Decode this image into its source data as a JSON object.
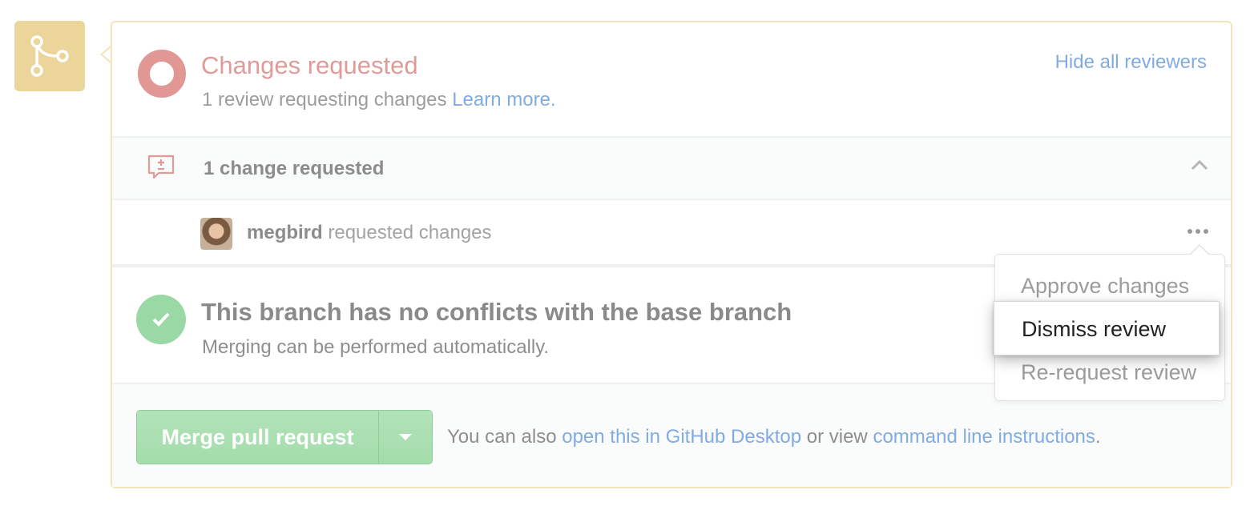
{
  "status": {
    "title": "Changes requested",
    "subtitle_prefix": "1 review requesting changes",
    "learn_more": "Learn more.",
    "hide_reviewers": "Hide all reviewers"
  },
  "summary": {
    "text": "1 change requested"
  },
  "reviewer": {
    "name": "megbird",
    "action": "requested changes"
  },
  "merge_status": {
    "title": "This branch has no conflicts with the base branch",
    "subtitle": "Merging can be performed automatically."
  },
  "actions": {
    "merge_button": "Merge pull request",
    "prefix": "You can also",
    "desktop_link": "open this in GitHub Desktop",
    "middle": "or view",
    "cli_link": "command line instructions",
    "suffix": "."
  },
  "dropdown": {
    "items": [
      {
        "label": "Approve changes"
      },
      {
        "label": "Dismiss review"
      },
      {
        "label": "Re-request review"
      }
    ]
  },
  "colors": {
    "changes_requested": "#e09b98",
    "link": "#82abe2",
    "merge_green": "#a3dcab",
    "branch_badge": "#ebd59a",
    "panel_border": "#f1e5bd"
  },
  "icons": {
    "badge": "git-branch-icon",
    "summary": "comment-diff-icon",
    "collapse": "chevron-up-icon",
    "menu": "kebab-horizontal-icon",
    "merge_ok": "check-icon",
    "merge_menu": "triangle-down-icon"
  }
}
